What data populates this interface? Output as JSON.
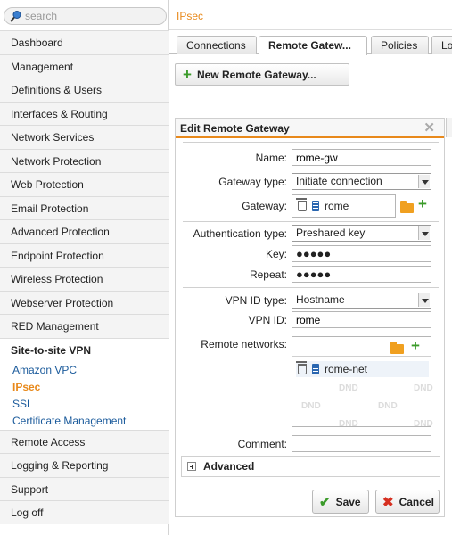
{
  "search": {
    "placeholder": "search"
  },
  "sidebar": {
    "items_top": [
      "Dashboard",
      "Management",
      "Definitions & Users",
      "Interfaces & Routing",
      "Network Services",
      "Network Protection",
      "Web Protection",
      "Email Protection",
      "Advanced Protection",
      "Endpoint Protection",
      "Wireless Protection",
      "Webserver Protection",
      "RED Management"
    ],
    "section_title": "Site-to-site VPN",
    "sub_items": [
      "Amazon VPC",
      "IPsec",
      "SSL",
      "Certificate Management"
    ],
    "items_bottom": [
      "Remote Access",
      "Logging & Reporting",
      "Support",
      "Log off"
    ]
  },
  "header": {
    "title": "IPsec"
  },
  "tabs": [
    "Connections",
    "Remote Gatew...",
    "Policies",
    "Lo"
  ],
  "new_button_label": "New Remote Gateway...",
  "dialog": {
    "title": "Edit Remote Gateway",
    "name_label": "Name:",
    "name_value": "rome-gw",
    "gateway_type_label": "Gateway type:",
    "gateway_type_value": "Initiate connection",
    "gateway_label": "Gateway:",
    "gateway_value": "rome",
    "auth_type_label": "Authentication type:",
    "auth_type_value": "Preshared key",
    "key_label": "Key:",
    "key_value": "●●●●●",
    "repeat_label": "Repeat:",
    "repeat_value": "●●●●●",
    "vpn_id_type_label": "VPN ID type:",
    "vpn_id_type_value": "Hostname",
    "vpn_id_label": "VPN ID:",
    "vpn_id_value": "rome",
    "remote_networks_label": "Remote networks:",
    "remote_network_item": "rome-net",
    "dnd_text": "DND",
    "comment_label": "Comment:",
    "comment_value": "",
    "advanced_label": "Advanced",
    "save_label": "Save",
    "cancel_label": "Cancel"
  },
  "colors": {
    "accent": "#e8891b",
    "link": "#1a5a9b",
    "add_green": "#3b9b2a",
    "cancel_red": "#d62f20"
  }
}
